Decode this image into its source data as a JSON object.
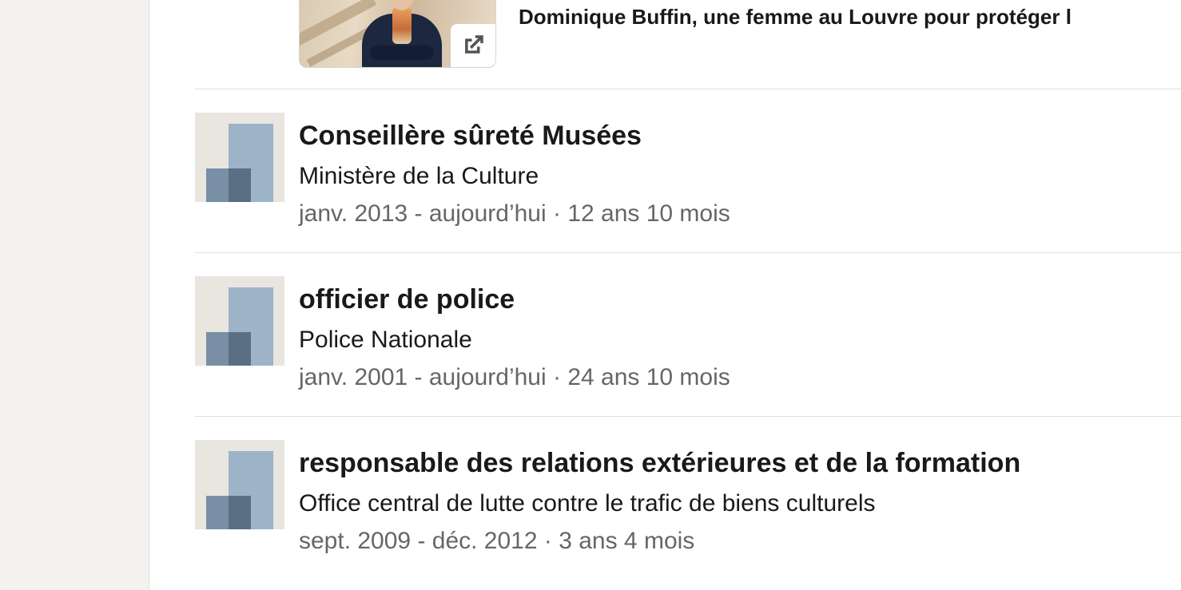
{
  "media": {
    "title": "Dominique Buffin, une femme au Louvre pour protéger l",
    "icon": "external-link-icon"
  },
  "experiences": [
    {
      "title": "Conseillère sûreté Musées",
      "org": "Ministère de la Culture",
      "dates": "janv. 2013 - aujourd’hui · 12 ans 10 mois",
      "logo": "company-logo-icon"
    },
    {
      "title": "officier de police",
      "org": "Police Nationale",
      "dates": "janv. 2001 - aujourd’hui · 24 ans 10 mois",
      "logo": "company-logo-icon"
    },
    {
      "title": "responsable des relations extérieures et de la formation",
      "org": "Office central de lutte contre le trafic de biens culturels",
      "dates": "sept. 2009 - déc. 2012 · 3 ans 4 mois",
      "logo": "company-logo-icon"
    }
  ],
  "colors": {
    "background": "#f3f2ef",
    "card": "#ffffff",
    "text": "#191919",
    "muted": "#666666",
    "divider": "#e0dfdc",
    "logo_light": "#9db3c7",
    "logo_mid": "#788fa6",
    "logo_dark": "#5c6e83"
  }
}
